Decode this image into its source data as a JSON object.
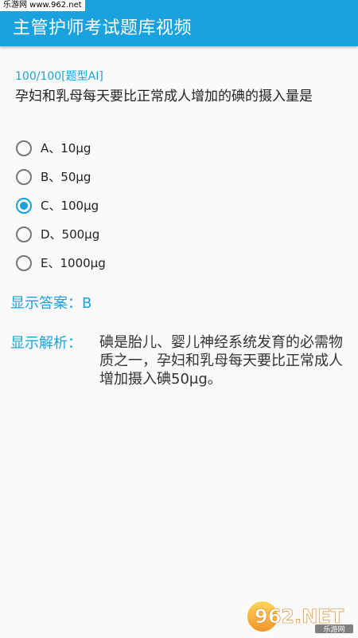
{
  "watermark_top": "乐游网 www.962.net",
  "header": {
    "title": "主管护师考试题库视频"
  },
  "question": {
    "progress": "100/100",
    "type_tag": "[题型AI]",
    "text": "孕妇和乳母每天要比正常成人增加的碘的摄入量是",
    "options": [
      {
        "label": "A、10μg",
        "selected": false
      },
      {
        "label": "B、50μg",
        "selected": false
      },
      {
        "label": "C、100μg",
        "selected": true
      },
      {
        "label": "D、500μg",
        "selected": false
      },
      {
        "label": "E、1000μg",
        "selected": false
      }
    ]
  },
  "answer": {
    "label": "显示答案：",
    "value": "B"
  },
  "analysis": {
    "label": "显示解析：",
    "text": "碘是胎儿、婴儿神经系统发育的必需物质之一，孕妇和乳母每天要比正常成人增加摄入碘50μg。"
  },
  "logo": {
    "brand": "962.NET",
    "subtitle": "乐游网"
  },
  "colors": {
    "accent": "#1aa2de",
    "text": "#222222",
    "background": "#fafafa"
  }
}
